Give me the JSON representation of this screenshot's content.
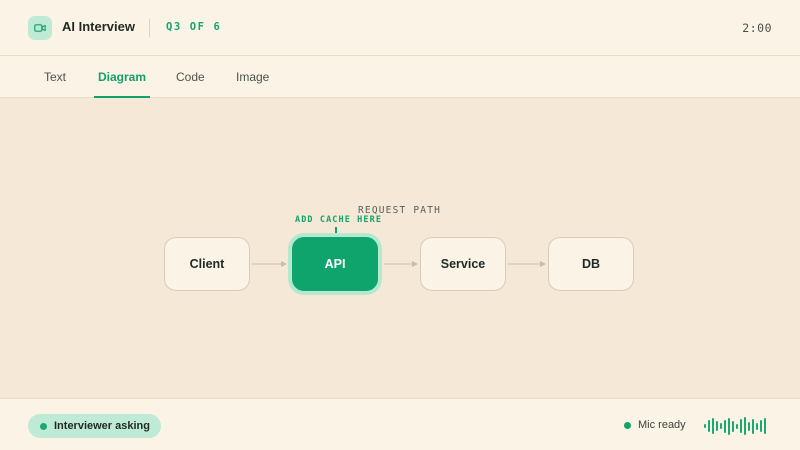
{
  "header": {
    "app_icon": "video-camera-icon",
    "title": "AI Interview",
    "question_counter": "Q3 OF 6",
    "timer": "2:00"
  },
  "tabs": [
    {
      "label": "Text",
      "active": false
    },
    {
      "label": "Diagram",
      "active": true
    },
    {
      "label": "Code",
      "active": false
    },
    {
      "label": "Image",
      "active": false
    }
  ],
  "diagram": {
    "path_label": "REQUEST PATH",
    "annotation": "ADD CACHE HERE",
    "nodes": [
      {
        "label": "Client",
        "highlighted": false
      },
      {
        "label": "API",
        "highlighted": true
      },
      {
        "label": "Service",
        "highlighted": false
      },
      {
        "label": "DB",
        "highlighted": false
      }
    ]
  },
  "footer": {
    "status_label": "Interviewer asking",
    "mic_label": "Mic ready",
    "waveform_icon": "audio-waveform-icon"
  },
  "colors": {
    "accent": "#14A06B",
    "accent_soft": "#BFEBD6",
    "background": "#FBF3E6",
    "canvas": "#F5E8D6"
  }
}
